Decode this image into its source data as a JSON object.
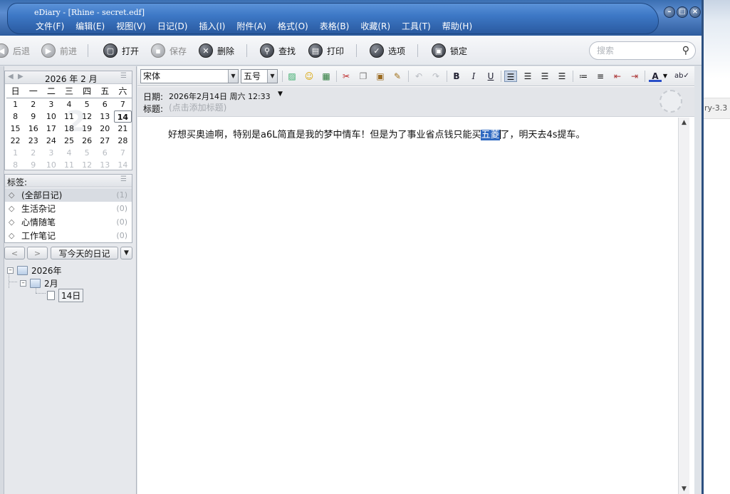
{
  "window": {
    "title": "eDiary - [Rhine - secret.edf]"
  },
  "menu": [
    "文件(F)",
    "编辑(E)",
    "视图(V)",
    "日记(D)",
    "插入(I)",
    "附件(A)",
    "格式(O)",
    "表格(B)",
    "收藏(R)",
    "工具(T)",
    "帮助(H)"
  ],
  "toolbar": {
    "back": "后退",
    "forward": "前进",
    "open": "打开",
    "save": "保存",
    "delete": "删除",
    "find": "查找",
    "print": "打印",
    "options": "选项",
    "lock": "锁定",
    "search_placeholder": "搜索"
  },
  "calendar": {
    "title": "2026 年 2 月",
    "watermark": "2",
    "weekdays": [
      "日",
      "一",
      "二",
      "三",
      "四",
      "五",
      "六"
    ],
    "days": [
      [
        "1",
        "cur"
      ],
      [
        "2",
        "cur"
      ],
      [
        "3",
        "cur"
      ],
      [
        "4",
        "cur"
      ],
      [
        "5",
        "cur"
      ],
      [
        "6",
        "cur"
      ],
      [
        "7",
        "cur"
      ],
      [
        "8",
        "cur"
      ],
      [
        "9",
        "cur"
      ],
      [
        "10",
        "cur"
      ],
      [
        "11",
        "cur"
      ],
      [
        "12",
        "cur"
      ],
      [
        "13",
        "cur"
      ],
      [
        "14",
        "today"
      ],
      [
        "15",
        "cur"
      ],
      [
        "16",
        "cur"
      ],
      [
        "17",
        "cur"
      ],
      [
        "18",
        "cur"
      ],
      [
        "19",
        "cur"
      ],
      [
        "20",
        "cur"
      ],
      [
        "21",
        "cur"
      ],
      [
        "22",
        "cur"
      ],
      [
        "23",
        "cur"
      ],
      [
        "24",
        "cur"
      ],
      [
        "25",
        "cur"
      ],
      [
        "26",
        "cur"
      ],
      [
        "27",
        "cur"
      ],
      [
        "28",
        "cur"
      ],
      [
        "1",
        "other"
      ],
      [
        "2",
        "other"
      ],
      [
        "3",
        "other"
      ],
      [
        "4",
        "other"
      ],
      [
        "5",
        "other"
      ],
      [
        "6",
        "other"
      ],
      [
        "7",
        "other"
      ],
      [
        "8",
        "other"
      ],
      [
        "9",
        "other"
      ],
      [
        "10",
        "other"
      ],
      [
        "11",
        "other"
      ],
      [
        "12",
        "other"
      ],
      [
        "13",
        "other"
      ],
      [
        "14",
        "other"
      ]
    ]
  },
  "tags": {
    "title": "标签:",
    "items": [
      {
        "label": "(全部日记)",
        "count": "(1)"
      },
      {
        "label": "生活杂记",
        "count": "(0)"
      },
      {
        "label": "心情随笔",
        "count": "(0)"
      },
      {
        "label": "工作笔记",
        "count": "(0)"
      }
    ]
  },
  "nav": {
    "write_today": "写今天的日记"
  },
  "tree": {
    "year": "2026年",
    "month": "2月",
    "day": "14日"
  },
  "format": {
    "font": "宋体",
    "size": "五号"
  },
  "entry": {
    "date_label": "日期:",
    "date_value": "2026年2月14日 周六 12:33",
    "title_label": "标题:",
    "title_placeholder": "(点击添加标题)",
    "text_before": "好想买奥迪啊，特别是a6L简直是我的梦中情车！但是为了事业省点钱只能买",
    "text_selected": "五菱",
    "text_after": "了，明天去4s提车。"
  },
  "background_window": {
    "text": "ry-3.3"
  }
}
